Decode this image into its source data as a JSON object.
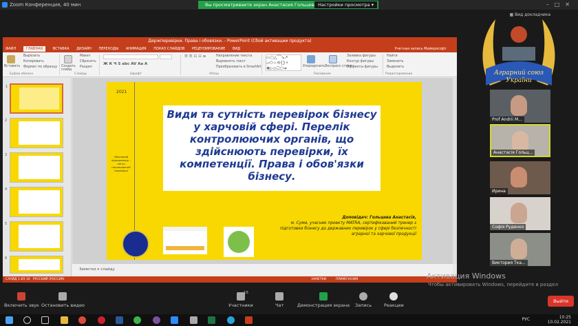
{
  "zoom": {
    "title": "Zoom Конференция, 40 мин",
    "share_banner": "Вы просматриваете экран Анастасия Гольцева",
    "view_options": "Настройки просмотра",
    "view_mode": "Вид докладчика"
  },
  "ppt": {
    "window_title": "Держперевірки. Права і обовязки. - PowerPoint (Сбой активации продукта)",
    "tabs": [
      "ФАЙЛ",
      "ГЛАВНАЯ",
      "ВСТАВКА",
      "ДИЗАЙН",
      "ПЕРЕХОДЫ",
      "АНИМАЦИЯ",
      "ПОКАЗ СЛАЙДОВ",
      "РЕЦЕНЗИРОВАНИЕ",
      "ВИД"
    ],
    "record_label": "Учетная запись Майкрософт",
    "ribbon": {
      "paste": "Вставить",
      "cut": "Вырезать",
      "copy": "Копировать",
      "format_painter": "Формат по образцу",
      "clipboard_group": "Буфер обмена",
      "create_slide": "Создать слайд",
      "layout": "Макет",
      "reset": "Сбросить",
      "section": "Раздел",
      "slides_group": "Слайды",
      "font_group": "Шрифт",
      "paragraph_group": "Абзац",
      "text_direction": "Направление текста",
      "align_text": "Выровнять текст",
      "smartart": "Преобразовать в SmartArt",
      "arrange": "Упорядочить",
      "quick_styles": "Экспресс-стили",
      "shape_fill": "Заливка фигуры",
      "shape_outline": "Контур фигуры",
      "shape_effects": "Эффекты фигуры",
      "drawing_group": "Рисование",
      "find": "Найти",
      "replace": "Заменить",
      "select": "Выделить",
      "editing_group": "Редактирование"
    },
    "thumb_numbers": [
      "1",
      "2",
      "3",
      "4",
      "5",
      "6"
    ],
    "slide": {
      "year": "2021",
      "side_text": "Обізнаний підприємець – легко пошанований перевірки",
      "headline": "Види та сутність перевірок бізнесу у харчовій сфері. Перелік контролюючих органів, що здійснюють перевірки, їх компетенції. Права і обов'язки бізнесу.",
      "author_label": "Доповідач: Гольцева Анастасія,",
      "author_text": "м. Суми, учасник проекту MATRA, сертифікований тренер з підготовки бізнесу до державних перевірок у сфері безпечності аграрної та харчової продукції"
    },
    "notes": "Заметки к слайду",
    "status_left": "СЛАЙД 1 ИЗ 16",
    "status_lang": "РУССКИЙ (РОССИЯ)",
    "status_notes": "ЗАМЕТКИ",
    "status_comments": "ПРИМЕЧАНИЯ"
  },
  "emblem": {
    "line1": "Аграрний союз",
    "line2": "України"
  },
  "participants": [
    {
      "name": "Prof Andrii M..."
    },
    {
      "name": "Анастасія Гольц..."
    },
    {
      "name": "Ирина"
    },
    {
      "name": "Софія Руденко"
    },
    {
      "name": "Виктория Тка..."
    }
  ],
  "watermark": {
    "title": "Активация Windows",
    "text": "Чтобы активировать Windows, перейдите в раздел \"Параметры\"."
  },
  "controls": {
    "audio": "Включить звук",
    "video": "Остановить видео",
    "participants": "Участники",
    "participants_count": "15",
    "chat": "Чат",
    "share": "Демонстрация экрана",
    "record": "Запись",
    "reactions": "Реакции",
    "leave": "Выйти"
  },
  "taskbar": {
    "lang": "РУС",
    "time": "10:25",
    "date": "10.02.2021"
  },
  "colors": {
    "ppt_accent": "#c43e1c",
    "slide_bg": "#f8d800",
    "headline": "#1f3a93",
    "zoom_green": "#23a04a",
    "leave": "#d9362b"
  }
}
